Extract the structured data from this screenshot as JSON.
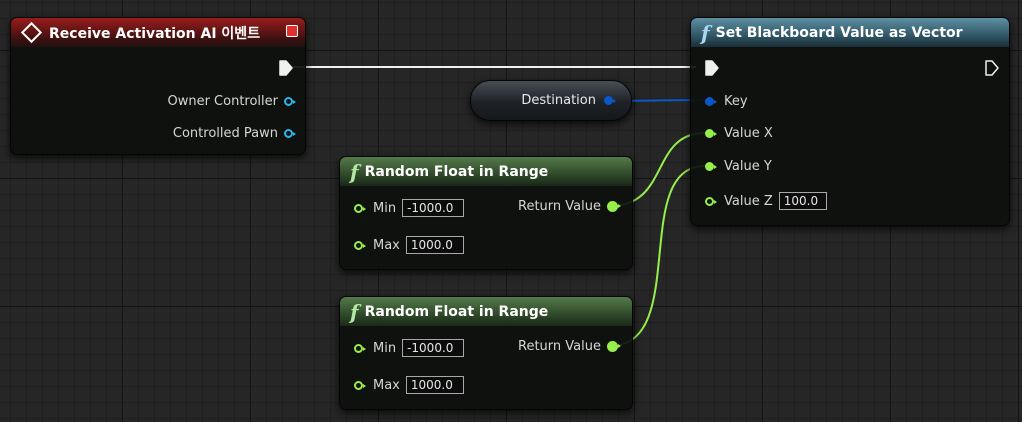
{
  "event_node": {
    "title": "Receive Activation AI 이벤트",
    "pins": [
      {
        "label": "Owner Controller"
      },
      {
        "label": "Controlled Pawn"
      }
    ]
  },
  "variable_node": {
    "label": "Destination"
  },
  "set_node": {
    "title": "Set Blackboard Value as Vector",
    "pins": {
      "key": "Key",
      "value_x": "Value X",
      "value_y": "Value Y",
      "value_z": "Value Z",
      "value_z_default": "100.0"
    }
  },
  "random_nodes": [
    {
      "title": "Random Float in Range",
      "min_label": "Min",
      "min_value": "-1000.0",
      "max_label": "Max",
      "max_value": "1000.0",
      "return_label": "Return Value"
    },
    {
      "title": "Random Float in Range",
      "min_label": "Min",
      "min_value": "-1000.0",
      "max_label": "Max",
      "max_value": "1000.0",
      "return_label": "Return Value"
    }
  ],
  "colors": {
    "float_pin": "#96ef4b",
    "vector_name_pin": "#0a58c8",
    "object_pin": "#28b4ec",
    "event_header": "#9a1c1c",
    "function_header": "#2d5261",
    "pure_header": "#2c4527"
  }
}
